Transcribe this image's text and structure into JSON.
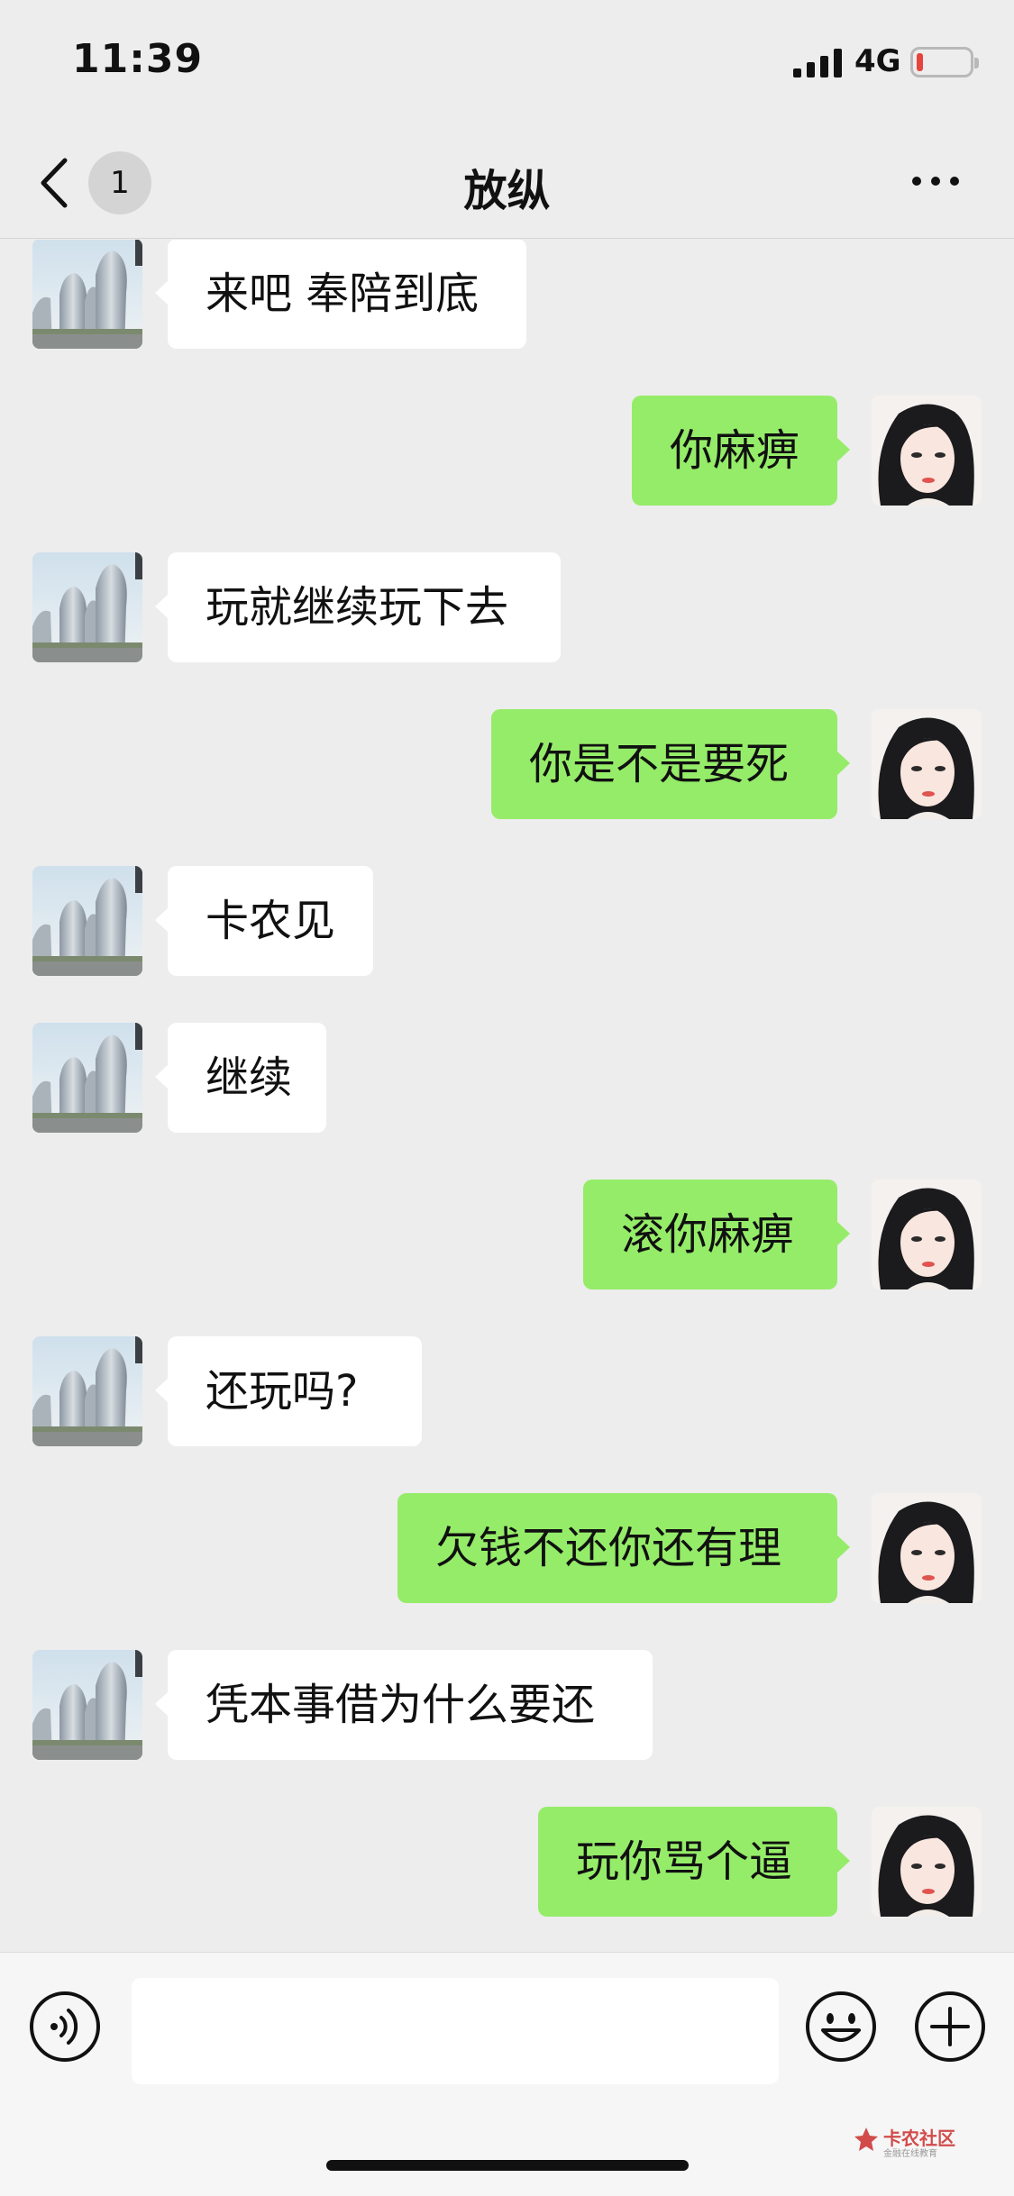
{
  "status_bar": {
    "time": "11:39",
    "network": "4G",
    "battery_level": 0.12,
    "battery_color": "#e5453d"
  },
  "nav": {
    "unread_count": "1",
    "title": "放纵"
  },
  "messages": [
    {
      "side": "left",
      "text": "来吧 奉陪到底"
    },
    {
      "side": "right",
      "text": "你麻痹"
    },
    {
      "side": "left",
      "text": "玩就继续玩下去"
    },
    {
      "side": "right",
      "text": "你是不是要死"
    },
    {
      "side": "left",
      "text": "卡农见"
    },
    {
      "side": "left",
      "text": "继续"
    },
    {
      "side": "right",
      "text": "滚你麻痹"
    },
    {
      "side": "left",
      "text": "还玩吗?"
    },
    {
      "side": "right",
      "text": "欠钱不还你还有理"
    },
    {
      "side": "left",
      "text": "凭本事借为什么要还"
    },
    {
      "side": "right",
      "text": "玩你骂个逼"
    }
  ],
  "input_bar": {
    "voice_icon": "voice-icon",
    "emoji_icon": "emoji-icon",
    "plus_icon": "plus-icon",
    "placeholder": ""
  },
  "watermark": {
    "brand": "卡农社区",
    "tagline": "金融在线教育"
  },
  "colors": {
    "background": "#ededed",
    "sent_bubble": "#95ec69",
    "received_bubble": "#ffffff"
  }
}
